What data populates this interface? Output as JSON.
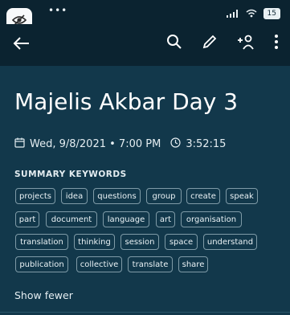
{
  "status_bar": {
    "dots": "•••",
    "battery": "15"
  },
  "toolbar": {
    "back_icon": "arrow-left-icon",
    "icons": [
      "search-icon",
      "pencil-icon",
      "add-person-icon",
      "more-vertical-icon"
    ]
  },
  "meeting": {
    "title": "Majelis Akbar Day 3",
    "date_time": "Wed, 9/8/2021 • 7:00 PM",
    "duration": "3:52:15"
  },
  "summary": {
    "heading": "SUMMARY KEYWORDS",
    "keywords": [
      "projects",
      "idea",
      "questions",
      "group",
      "create",
      "speak",
      "part",
      "document",
      "language",
      "art",
      "organisation",
      "translation",
      "thinking",
      "session",
      "space",
      "understand",
      "publication",
      "collective",
      "translate",
      "share"
    ],
    "show_fewer_label": "Show fewer"
  }
}
